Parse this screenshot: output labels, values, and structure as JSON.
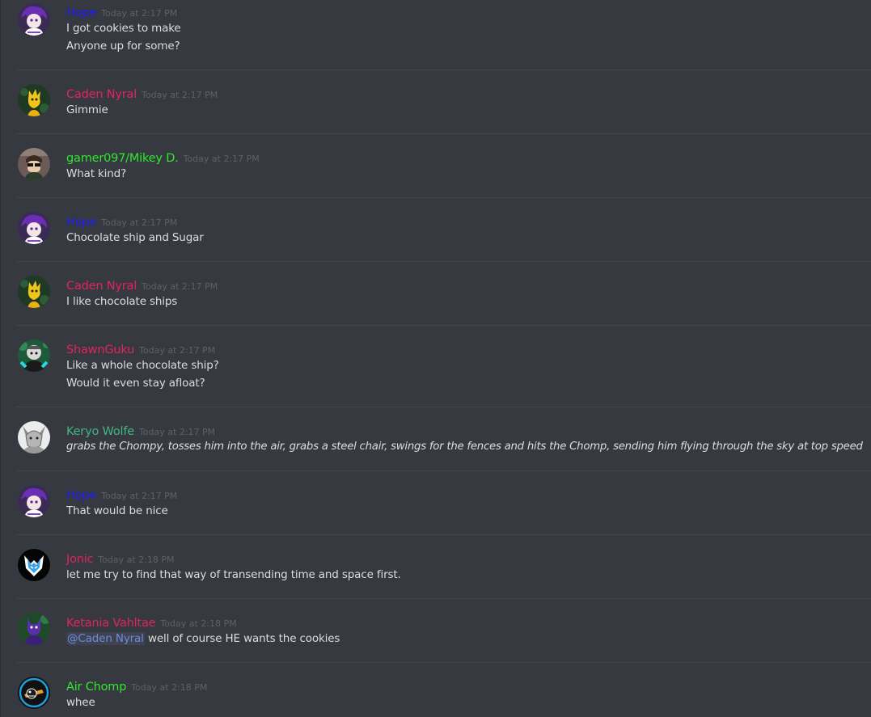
{
  "colors": {
    "background": "#36393f",
    "hope": "#1c1cff",
    "caden": "#e0245e",
    "mikey": "#2ee82e",
    "shawn": "#e0245e",
    "keryo": "#43b581",
    "jonic": "#e0245e",
    "ketania": "#e0245e",
    "airchomp": "#2ee82e",
    "mention": "#7289da"
  },
  "messages": [
    {
      "author": "Hope",
      "timestamp": "Today at 2:17 PM",
      "avatar_icon": "purple-hair-character-avatar-icon",
      "lines": [
        "I got cookies to make",
        "Anyone up for some?"
      ]
    },
    {
      "author": "Caden Nyral",
      "timestamp": "Today at 2:17 PM",
      "avatar_icon": "yellow-character-avatar-icon",
      "lines": [
        "Gimmie"
      ]
    },
    {
      "author": "gamer097/Mikey D.",
      "timestamp": "Today at 2:17 PM",
      "avatar_icon": "glasses-character-avatar-icon",
      "lines": [
        "What kind?"
      ]
    },
    {
      "author": "Hope",
      "timestamp": "Today at 2:17 PM",
      "avatar_icon": "purple-hair-character-avatar-icon",
      "lines": [
        "Chocolate ship and Sugar"
      ]
    },
    {
      "author": "Caden Nyral",
      "timestamp": "Today at 2:17 PM",
      "avatar_icon": "yellow-character-avatar-icon",
      "lines": [
        "I like chocolate ships"
      ]
    },
    {
      "author": "ShawnGuku",
      "timestamp": "Today at 2:17 PM",
      "avatar_icon": "teal-character-avatar-icon",
      "lines": [
        "Like a whole chocolate ship?",
        "Would it even stay afloat?"
      ]
    },
    {
      "author": "Keryo Wolfe",
      "timestamp": "Today at 2:17 PM",
      "avatar_icon": "grey-wolf-avatar-icon",
      "lines": [
        "grabs the Chompy, tosses him into the air, grabs a steel chair, swings for the fences and hits the Chomp, sending him flying through the sky at top speed"
      ]
    },
    {
      "author": "Hope",
      "timestamp": "Today at 2:17 PM",
      "avatar_icon": "purple-hair-character-avatar-icon",
      "lines": [
        "That would  be nice"
      ]
    },
    {
      "author": "Jonic",
      "timestamp": "Today at 2:18 PM",
      "avatar_icon": "blue-fox-logo-avatar-icon",
      "lines": [
        "let me try to find that way of transending time and space first."
      ]
    },
    {
      "author": "Ketania Vahltae",
      "timestamp": "Today at 2:18 PM",
      "avatar_icon": "purple-cat-avatar-icon",
      "mention": "@Caden Nyral",
      "lines": [
        " well of course HE wants the cookies"
      ]
    },
    {
      "author": "Air Chomp",
      "timestamp": "Today at 2:18 PM",
      "avatar_icon": "chomp-airplane-avatar-icon",
      "lines": [
        "whee"
      ]
    }
  ]
}
